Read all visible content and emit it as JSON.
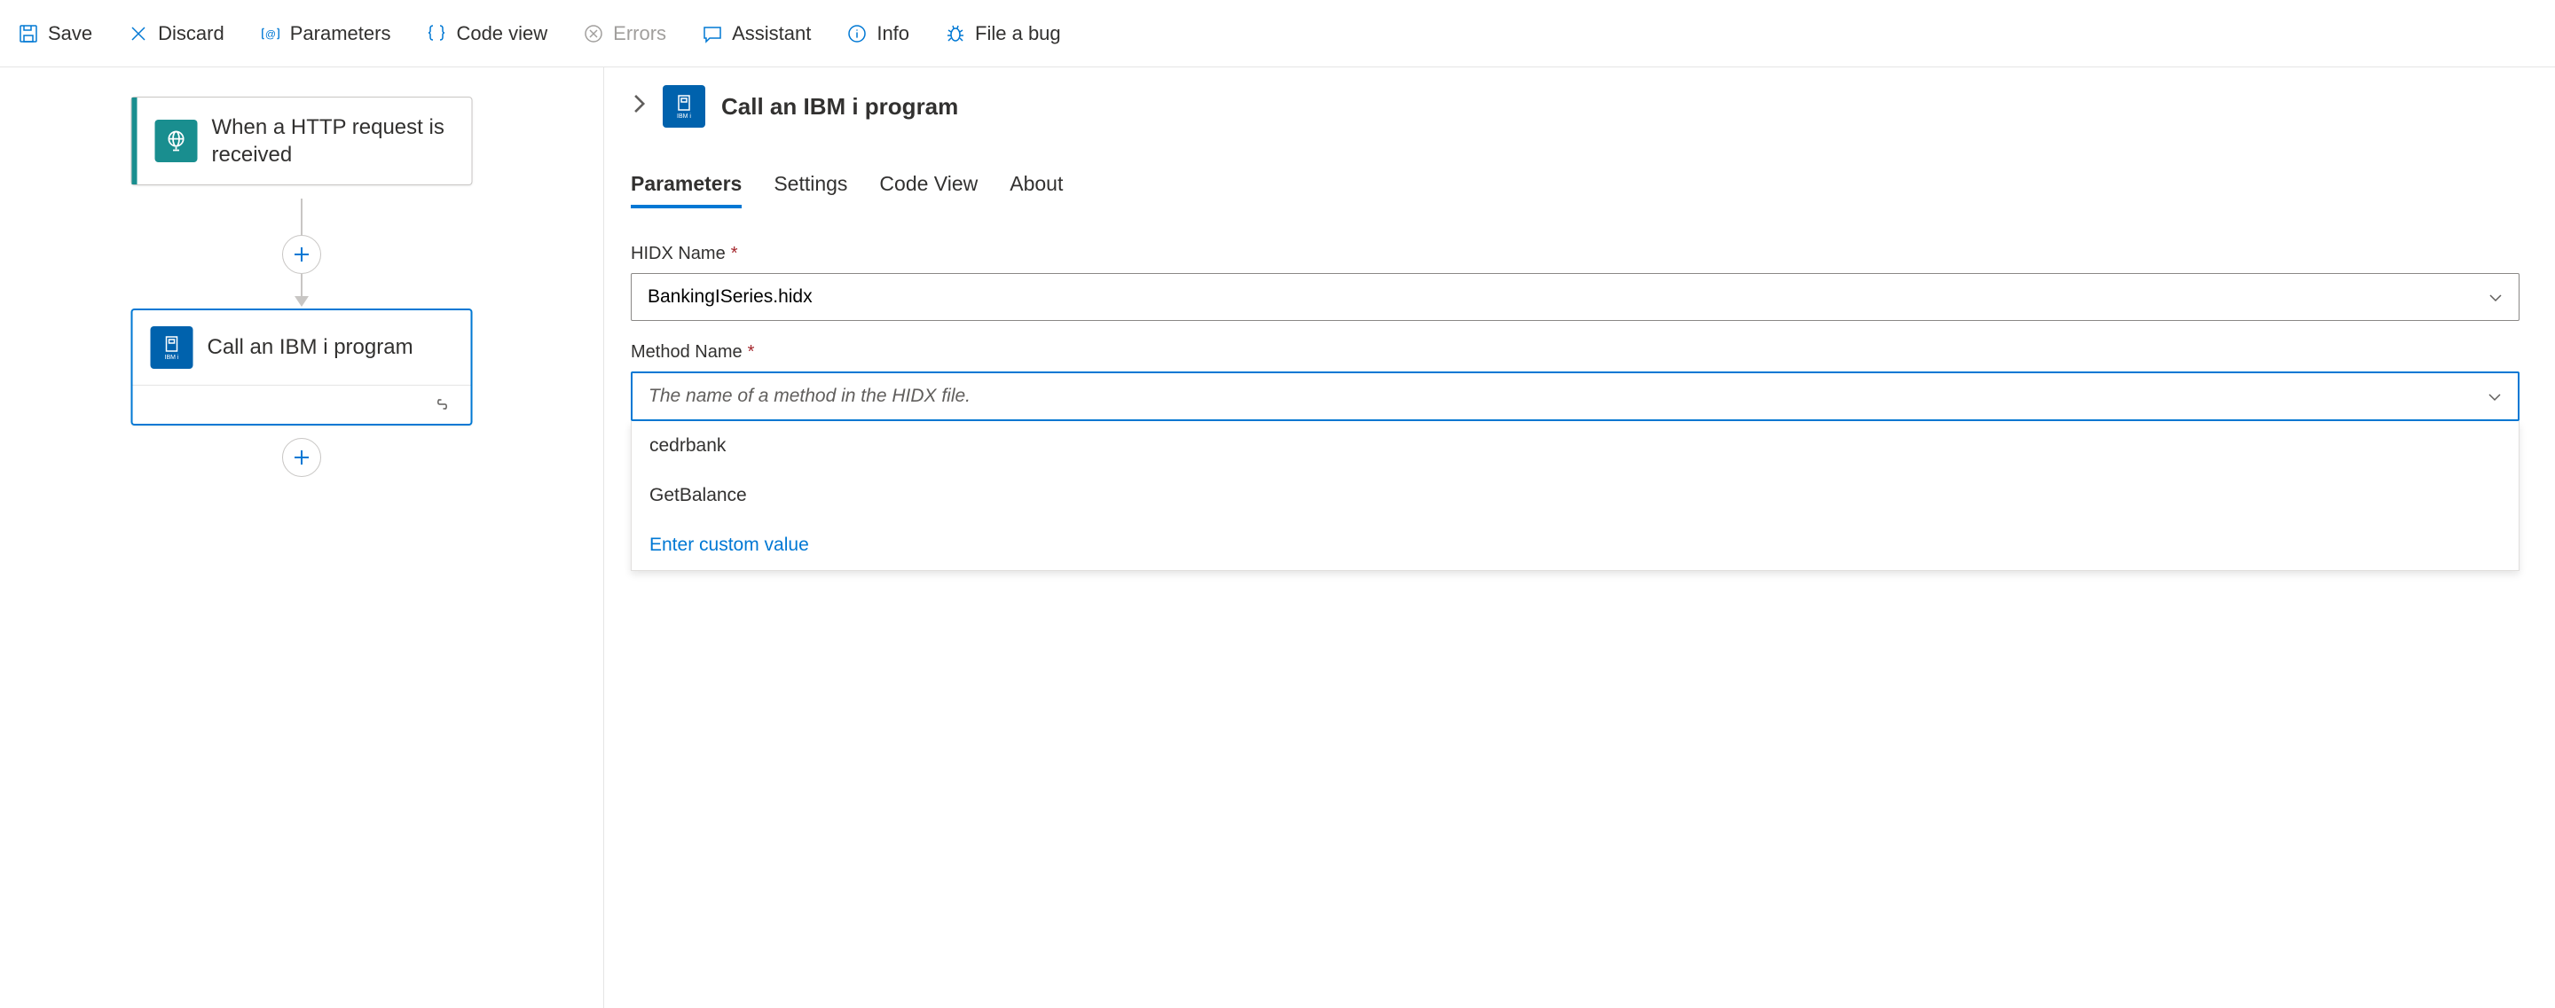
{
  "toolbar": {
    "save": "Save",
    "discard": "Discard",
    "parameters": "Parameters",
    "codeView": "Code view",
    "errors": "Errors",
    "assistant": "Assistant",
    "info": "Info",
    "fileBug": "File a bug"
  },
  "canvas": {
    "triggerNode": {
      "title": "When a HTTP request is received",
      "iconLabel": ""
    },
    "actionNode": {
      "title": "Call an IBM i program",
      "iconLabel": "IBM i"
    }
  },
  "panel": {
    "title": "Call an IBM i program",
    "iconLabel": "IBM i",
    "tabs": {
      "parameters": "Parameters",
      "settings": "Settings",
      "codeView": "Code View",
      "about": "About"
    },
    "fields": {
      "hidxName": {
        "label": "HIDX Name",
        "value": "BankingISeries.hidx"
      },
      "methodName": {
        "label": "Method Name",
        "placeholder": "The name of a method in the HIDX file.",
        "options": [
          "cedrbank",
          "GetBalance"
        ],
        "customOption": "Enter custom value"
      }
    }
  }
}
